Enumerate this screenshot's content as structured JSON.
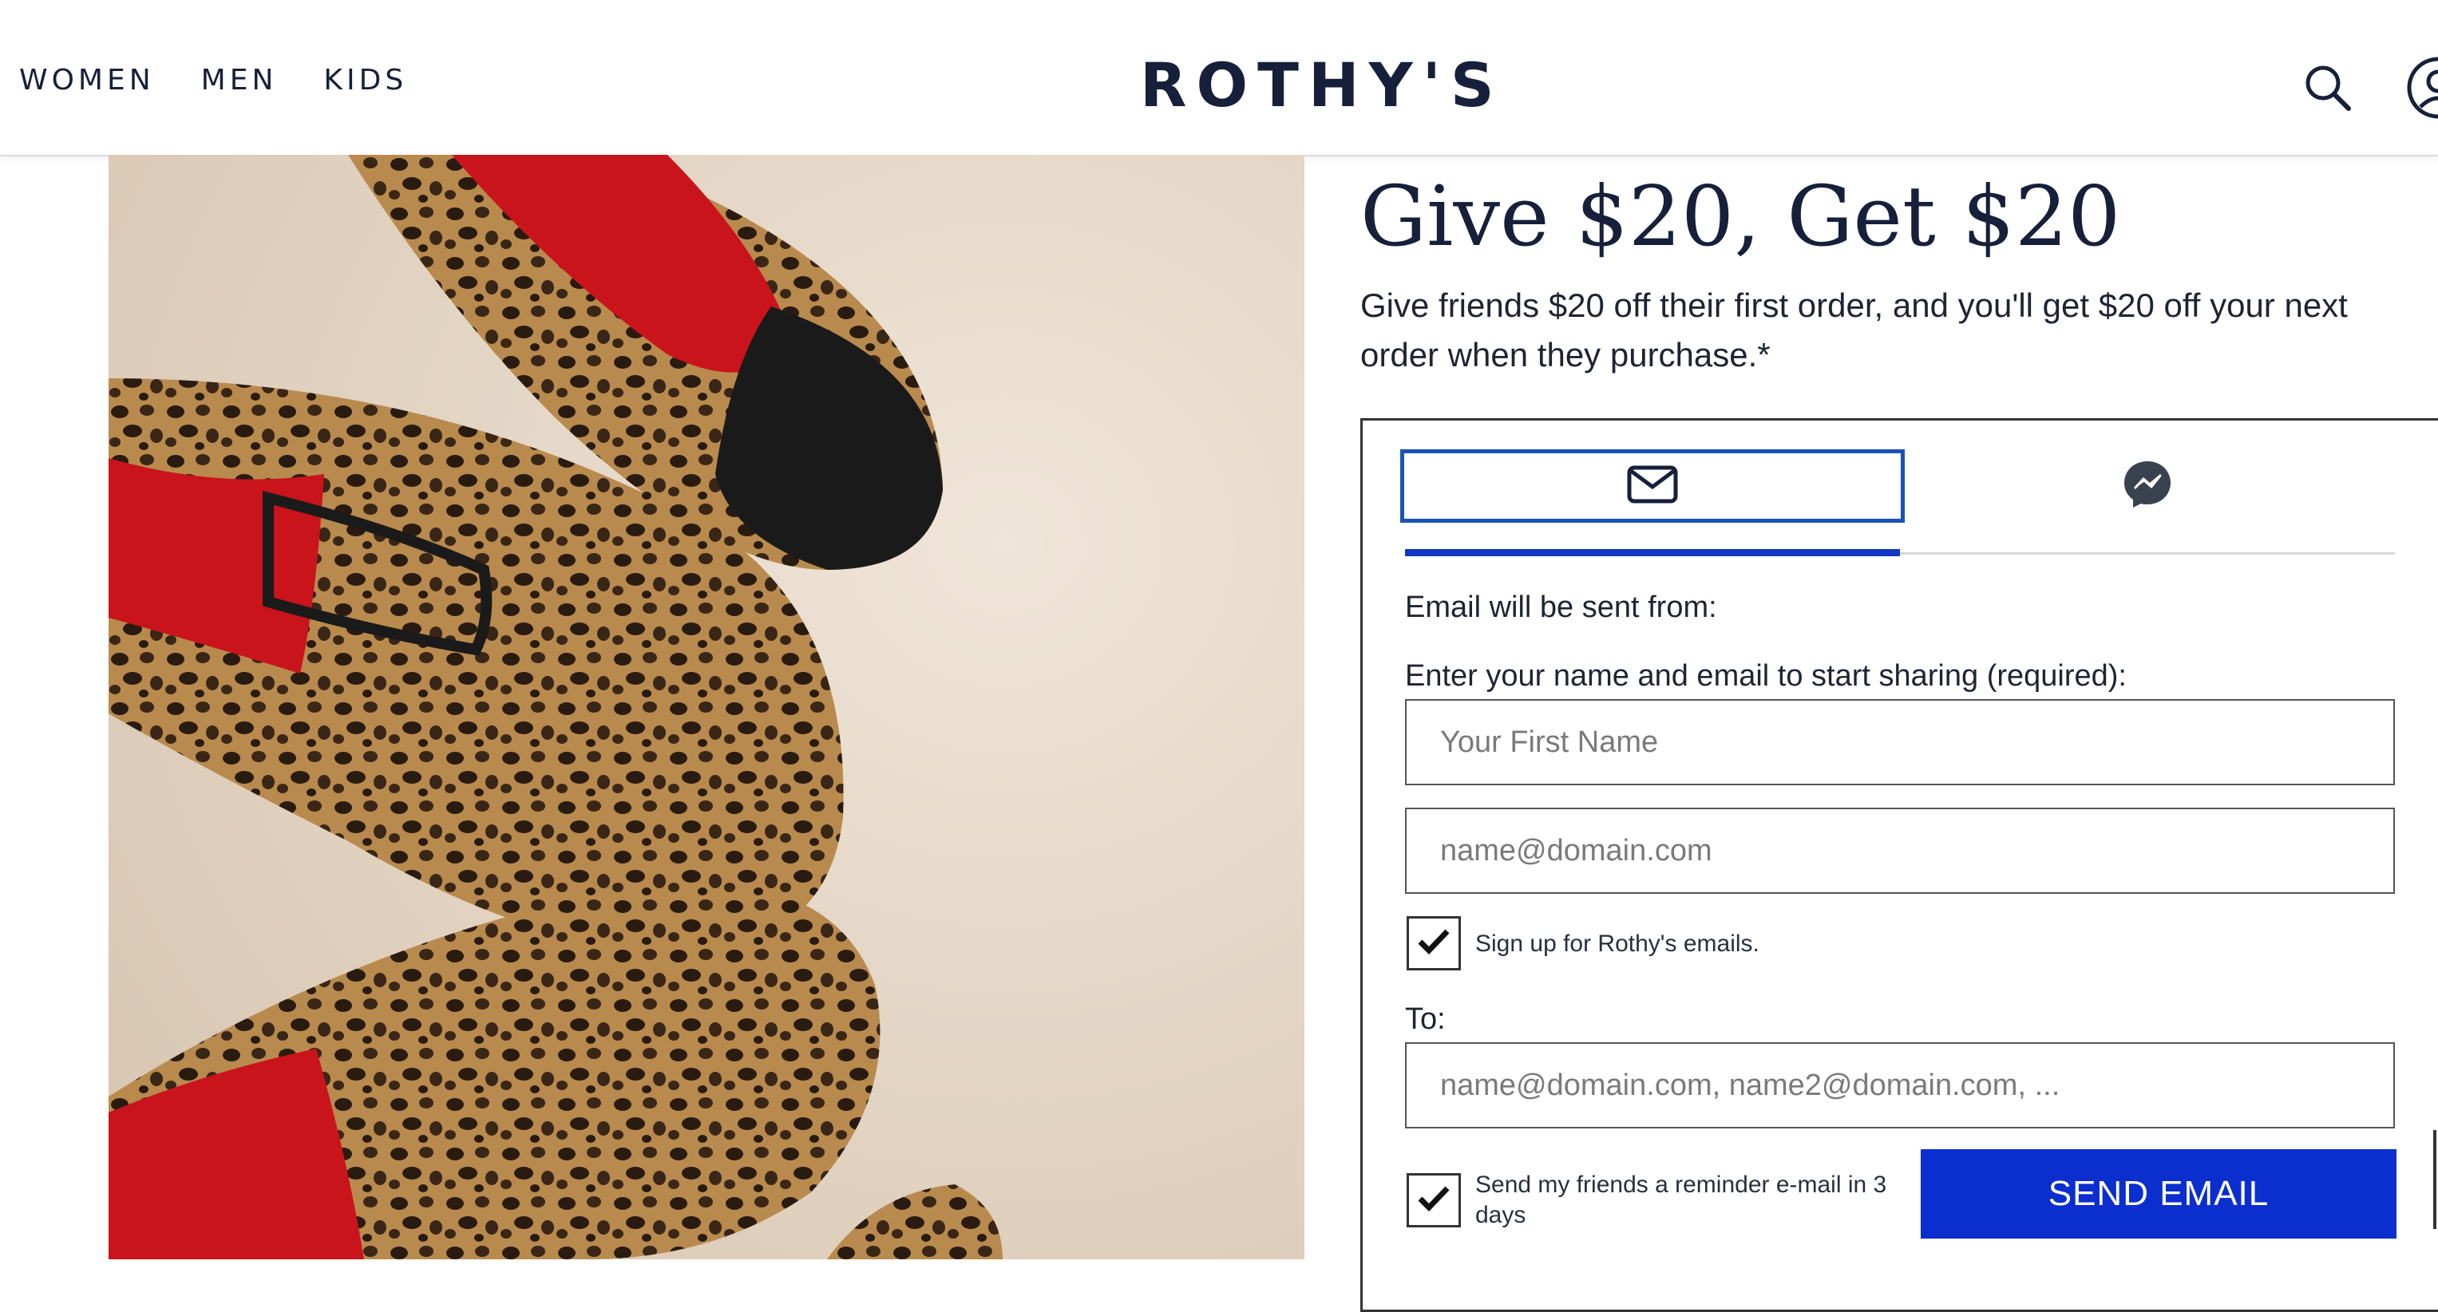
{
  "nav": {
    "women": "WOMEN",
    "men": "MEN",
    "kids": "KIDS"
  },
  "brand": {
    "logo": "ROTHY'S"
  },
  "header_icons": [
    "search-icon",
    "account-icon"
  ],
  "hero": {
    "image_icon": "leopard-print-shoes-photo"
  },
  "referral": {
    "headline": "Give $20, Get $20",
    "subtext": "Give friends $20 off their first order, and you'll get $20 off your next order when they purchase.*",
    "tabs": [
      {
        "icon": "mail-icon",
        "active": true
      },
      {
        "icon": "messenger-icon",
        "active": false
      }
    ],
    "sent_from_label": "Email will be sent from:",
    "enter_label": "Enter your name and email to start sharing (required):",
    "first_name_placeholder": "Your First Name",
    "email_placeholder": "name@domain.com",
    "signup_label": "Sign up for Rothy's emails.",
    "signup_checked": true,
    "to_label": "To:",
    "to_placeholder": "name@domain.com, name2@domain.com, ...",
    "reminder_label": "Send my friends a reminder e-mail in 3 days",
    "reminder_checked": true,
    "send_button": "SEND EMAIL"
  },
  "colors": {
    "brand_navy": "#16203a",
    "accent_blue": "#0b2ecf",
    "tab_border": "#1a53b8"
  }
}
